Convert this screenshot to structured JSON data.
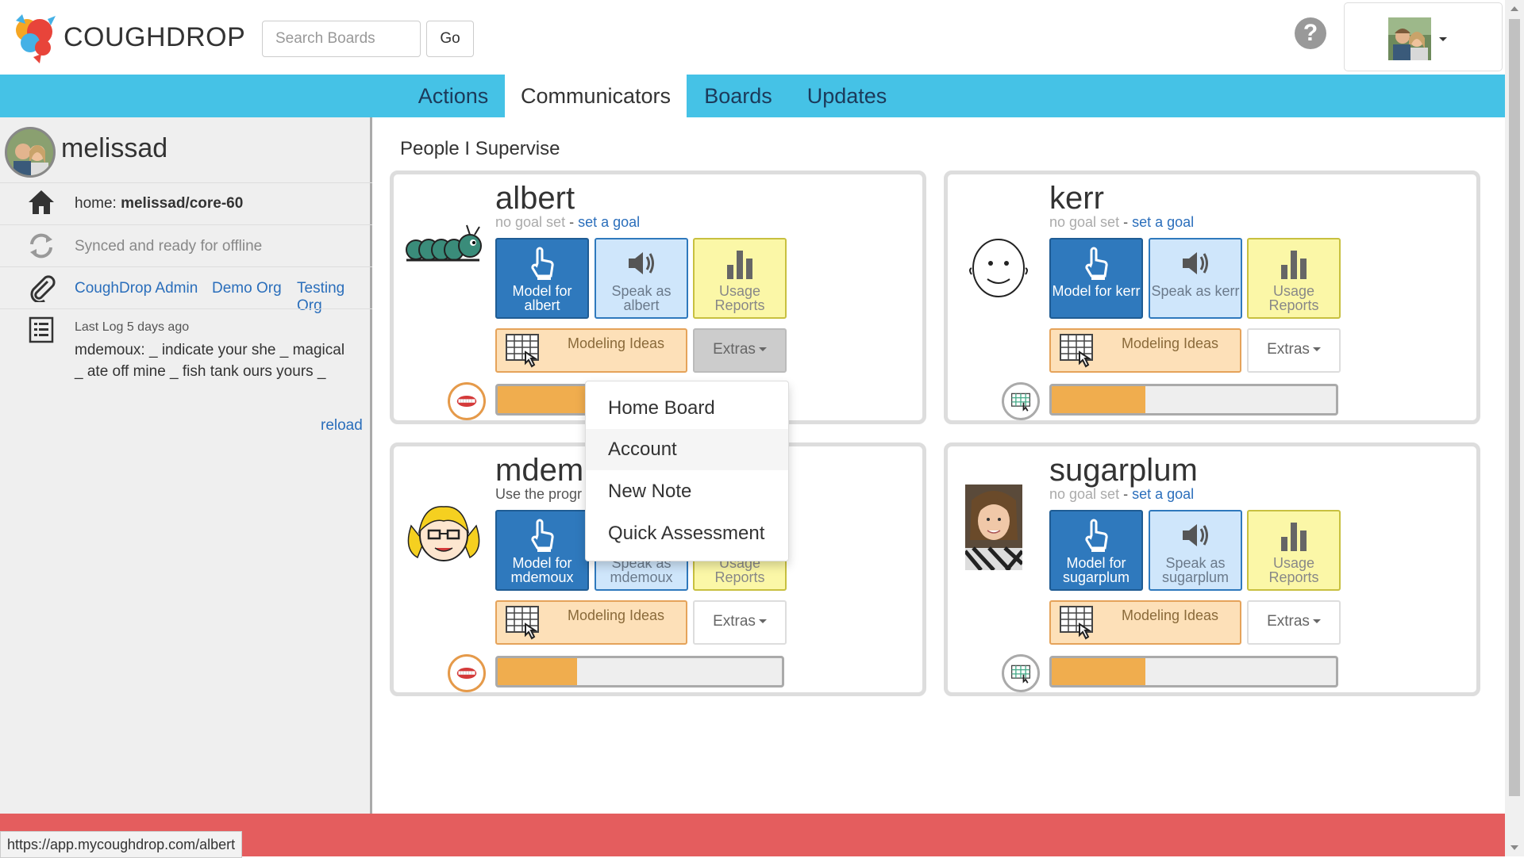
{
  "app": {
    "brand": "COUGHDROP"
  },
  "search": {
    "placeholder": "Search Boards",
    "go_label": "Go"
  },
  "nav": {
    "tabs": [
      "Actions",
      "Communicators",
      "Boards",
      "Updates"
    ],
    "active": "Communicators"
  },
  "sidebar": {
    "username": "melissad",
    "home_prefix": "home: ",
    "home_board": "melissad/core-60",
    "sync_status": "Synced and ready for offline",
    "orgs": [
      "CoughDrop Admin",
      "Demo Org",
      "Testing Org"
    ],
    "last_log_label": "Last Log 5 days ago",
    "last_log_text": "mdemoux: _ indicate your she _ magical _ ate off mine _ fish tank ours yours _",
    "reload_label": "reload"
  },
  "main": {
    "section_title": "People I Supervise",
    "cards": [
      {
        "name": "albert",
        "goal_status": "no goal set",
        "goal_separator": " - ",
        "goal_link": "set a goal",
        "model_label": "Model for albert",
        "speak_label": "Speak as albert",
        "usage_label": "Usage Reports",
        "modeling_label": "Modeling Ideas",
        "extras_label": "Extras",
        "progress": 0.45
      },
      {
        "name": "kerr",
        "goal_status": "no goal set",
        "goal_separator": " - ",
        "goal_link": "set a goal",
        "model_label": "Model for kerr",
        "speak_label": "Speak as kerr",
        "usage_label": "Usage Reports",
        "modeling_label": "Modeling Ideas",
        "extras_label": "Extras",
        "progress": 0.33
      },
      {
        "name": "mdem",
        "goal_status": "Use the progr",
        "goal_separator": "",
        "goal_link": "",
        "model_label": "Model for mdemoux",
        "speak_label": "Speak as mdemoux",
        "usage_label": "Usage Reports",
        "modeling_label": "Modeling Ideas",
        "extras_label": "Extras",
        "progress": 0.28
      },
      {
        "name": "sugarplum",
        "goal_status": "no goal set",
        "goal_separator": " - ",
        "goal_link": "set a goal",
        "model_label": "Model for sugarplum",
        "speak_label": "Speak as sugarplum",
        "usage_label": "Usage Reports",
        "modeling_label": "Modeling Ideas",
        "extras_label": "Extras",
        "progress": 0.33
      }
    ]
  },
  "extras_menu": {
    "items": [
      "Home Board",
      "Account",
      "New Note",
      "Quick Assessment"
    ],
    "highlighted": "Account"
  },
  "status_bar": {
    "url": "https://app.mycoughdrop.com/albert"
  },
  "colors": {
    "nav": "#45c2e6",
    "footer": "#e45d5e",
    "model_tile": "#2f79bd",
    "speak_tile": "#cfe6fb",
    "usage_tile": "#fbf7a7",
    "modeling_tile": "#fde0b8",
    "progress_fill": "#f0ad4e"
  },
  "icons": [
    "coughdrop-logo",
    "help-icon",
    "home-icon",
    "sync-icon",
    "paperclip-icon",
    "log-icon",
    "hand-pointer-icon",
    "speaker-icon",
    "bar-chart-icon",
    "board-grid-icon",
    "caterpillar-avatar",
    "smiley-avatar",
    "girl-avatar",
    "lips-icon",
    "grid-badge-icon"
  ]
}
